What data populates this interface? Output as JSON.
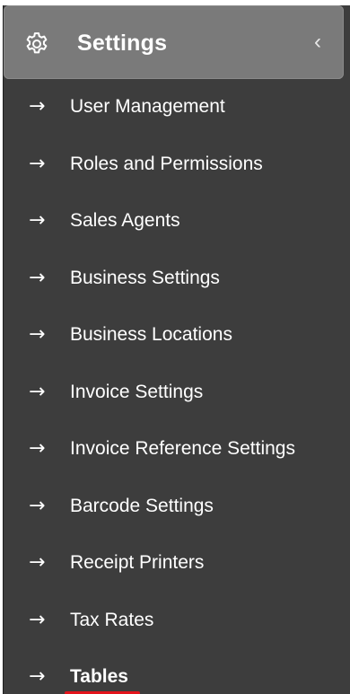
{
  "header": {
    "title": "Settings",
    "icon": "gear-icon",
    "collapse_icon": "chevron-left-icon",
    "collapse_glyph": "‹"
  },
  "menu": {
    "arrow_glyph": "→",
    "items": [
      {
        "label": "User Management"
      },
      {
        "label": "Roles and Permissions"
      },
      {
        "label": "Sales Agents"
      },
      {
        "label": "Business Settings"
      },
      {
        "label": "Business Locations"
      },
      {
        "label": "Invoice Settings"
      },
      {
        "label": "Invoice Reference Settings"
      },
      {
        "label": "Barcode Settings"
      },
      {
        "label": "Receipt Printers"
      },
      {
        "label": "Tax Rates"
      },
      {
        "label": "Tables",
        "active": true
      }
    ]
  },
  "colors": {
    "sidebar_bg": "#3d3d3d",
    "header_bg": "#7a7a7a",
    "text": "#ffffff",
    "active_underline": "#e3141b"
  }
}
